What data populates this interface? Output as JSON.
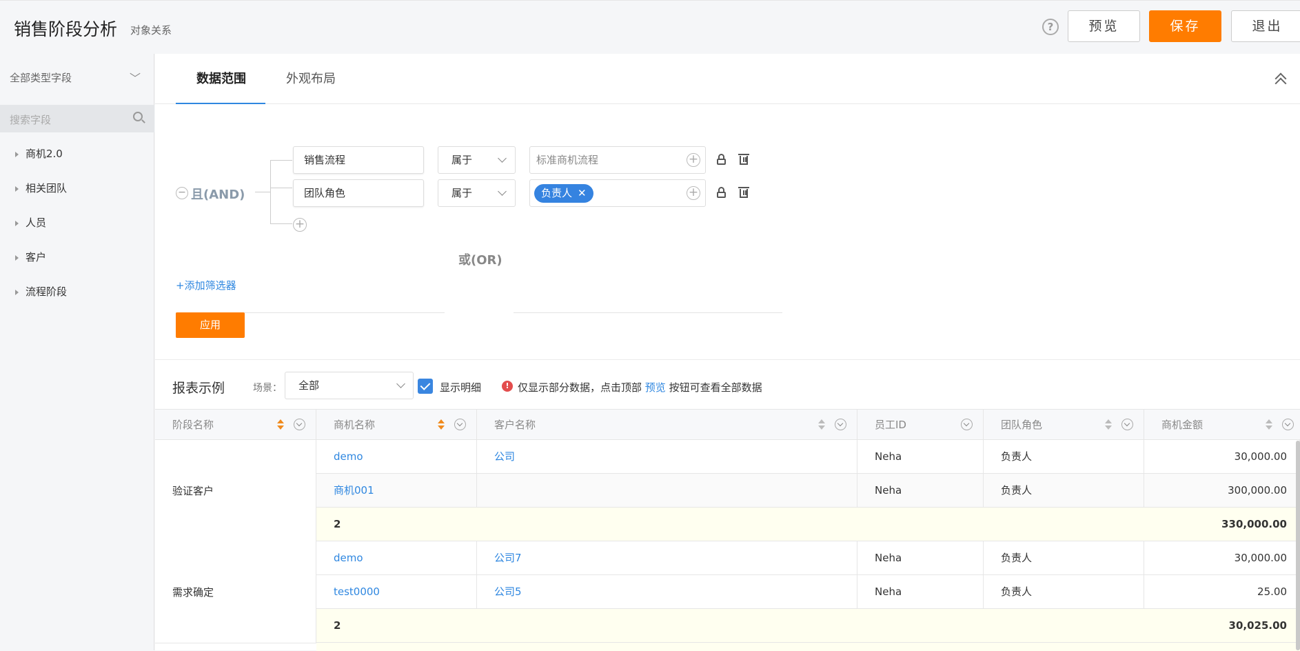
{
  "header": {
    "title": "销售阶段分析",
    "subtitle": "对象关系",
    "help_glyph": "?",
    "preview_label": "预览",
    "save_label": "保存",
    "exit_label": "退出"
  },
  "sidebar": {
    "type_filter": "全部类型字段",
    "search_placeholder": "搜索字段",
    "items": [
      {
        "label": "商机2.0"
      },
      {
        "label": "相关团队"
      },
      {
        "label": "人员"
      },
      {
        "label": "客户"
      },
      {
        "label": "流程阶段"
      }
    ]
  },
  "tabs": [
    {
      "label": "数据范围",
      "active": true
    },
    {
      "label": "外观布局",
      "active": false
    }
  ],
  "filter": {
    "logic_label": "且(AND)",
    "minus_glyph": "−",
    "plus_glyph": "+",
    "conditions": [
      {
        "field": "销售流程",
        "operator": "属于",
        "value_placeholder": "标准商机流程",
        "tags": []
      },
      {
        "field": "团队角色",
        "operator": "属于",
        "value_placeholder": "",
        "tags": [
          {
            "label": "负责人",
            "remove": "✕"
          }
        ]
      }
    ],
    "or_label": "或(OR)",
    "add_filter_label": "+添加筛选器",
    "apply_label": "应用"
  },
  "report": {
    "title": "报表示例",
    "scene_label": "场景：",
    "scene_value": "全部",
    "show_detail_label": "显示明细",
    "show_detail_checked": true,
    "warn_glyph": "!",
    "notice_prefix": "仅显示部分数据，点击顶部",
    "notice_link": "预览",
    "notice_suffix": "按钮可查看全部数据",
    "columns": [
      {
        "label": "阶段名称"
      },
      {
        "label": "商机名称"
      },
      {
        "label": "客户名称"
      },
      {
        "label": "员工ID"
      },
      {
        "label": "团队角色"
      },
      {
        "label": "商机金额"
      }
    ],
    "groups": [
      {
        "stage": "验证客户",
        "rows": [
          {
            "opportunity": "demo",
            "customer": "公司",
            "employee": "Neha",
            "role": "负责人",
            "amount": "30,000.00"
          },
          {
            "opportunity": "商机001",
            "customer": "",
            "employee": "Neha",
            "role": "负责人",
            "amount": "300,000.00"
          }
        ],
        "count": "2",
        "total": "330,000.00"
      },
      {
        "stage": "需求确定",
        "rows": [
          {
            "opportunity": "demo",
            "customer": "公司7",
            "employee": "Neha",
            "role": "负责人",
            "amount": "30,000.00"
          },
          {
            "opportunity": "test0000",
            "customer": "公司5",
            "employee": "Neha",
            "role": "负责人",
            "amount": "25.00"
          }
        ],
        "count": "2",
        "total": "30,025.00"
      }
    ]
  },
  "colors": {
    "accent_orange": "#ff7c00",
    "link_blue": "#2f87e0",
    "subtotal_bg": "#fffff0"
  }
}
